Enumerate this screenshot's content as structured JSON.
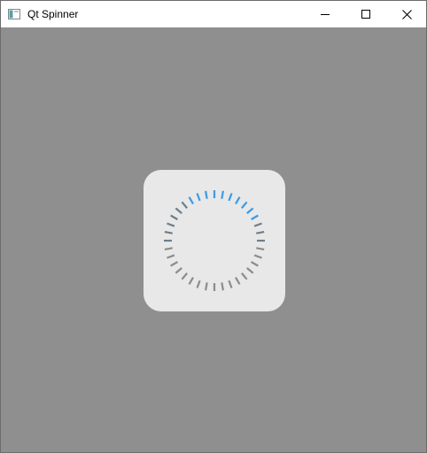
{
  "window": {
    "title": "Qt Spinner"
  },
  "icons": {
    "app": "app-window-icon",
    "minimize": "minimize-icon",
    "maximize": "maximize-icon",
    "close": "close-icon"
  },
  "spinner": {
    "segment_count": 36,
    "highlighted_segments": 10,
    "active_color": "#3a9be6",
    "inactive_color_top": "#6f7e8a",
    "inactive_color_bottom": "#8c8c8c",
    "card_color": "#e8e8e8",
    "backdrop_color": "#8f8f8f"
  }
}
